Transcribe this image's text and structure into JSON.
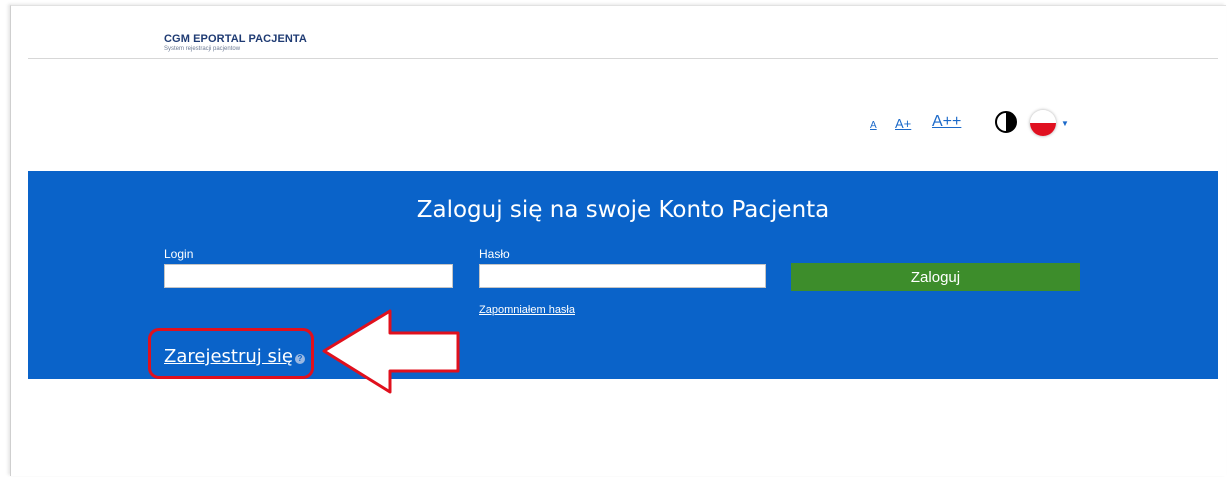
{
  "header": {
    "logo_title": "CGM EPORTAL PACJENTA",
    "logo_subtitle": "System rejestracji pacjentow"
  },
  "accessibility": {
    "font_small": "A",
    "font_medium": "A+",
    "font_large": "A++",
    "contrast_icon": "contrast-icon",
    "language_icon": "poland-flag-icon",
    "language_caret": "▼"
  },
  "login": {
    "title": "Zaloguj się na swoje Konto Pacjenta",
    "login_label": "Login",
    "password_label": "Hasło",
    "submit_label": "Zaloguj",
    "forgot_password": "Zapomniałem hasła",
    "register_label": "Zarejestruj się",
    "info_icon": "?"
  },
  "colors": {
    "panel_blue": "#0a63c9",
    "button_green": "#3d8d2b",
    "annotation_red": "#e0101d",
    "link_blue": "#1b69c9"
  }
}
